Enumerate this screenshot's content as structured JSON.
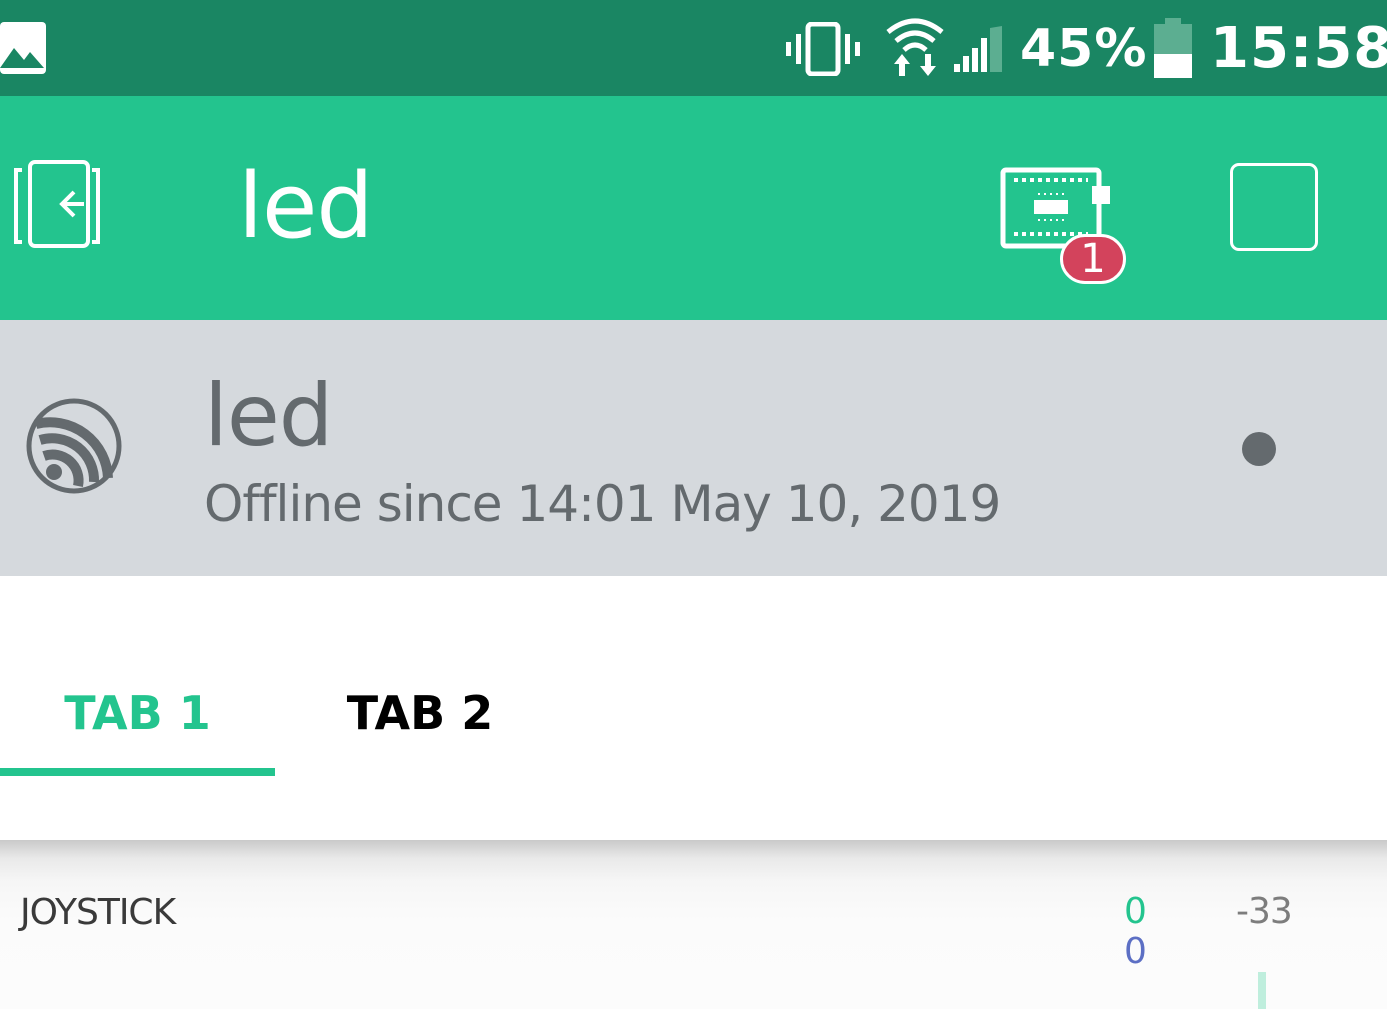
{
  "status_bar": {
    "battery_percent": "45%",
    "battery_level": 0.45,
    "time": "15:58",
    "icons": [
      "gallery-icon",
      "vibrate-icon",
      "wifi-icon",
      "signal-icon",
      "battery-icon"
    ]
  },
  "app_bar": {
    "title": "led",
    "device_badge_count": "1",
    "icons": [
      "back-icon",
      "device-icon",
      "stop-icon"
    ]
  },
  "device": {
    "name": "led",
    "status_text": "Offline since 14:01 May 10, 2019",
    "icon": "esp-icon"
  },
  "tabs": [
    {
      "label": "TAB 1",
      "active": true
    },
    {
      "label": "TAB 2",
      "active": false
    }
  ],
  "widget": {
    "label": "JOYSTICK",
    "x_value": "0",
    "y_value": "0",
    "extra_value": "-33"
  },
  "colors": {
    "status_bar_bg": "#1a8663",
    "accent": "#23c48e",
    "device_panel_bg": "#d5d9dd",
    "badge": "#d3435c",
    "y_value": "#5c6fc4",
    "device_text": "#646a6e"
  }
}
